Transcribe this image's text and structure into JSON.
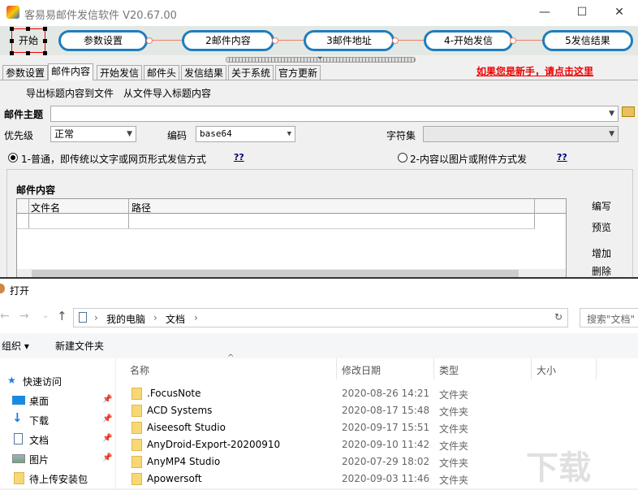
{
  "window": {
    "title": "客易易邮件发信软件 V20.67.00",
    "min": "—",
    "max": "☐",
    "close": "✕"
  },
  "flow": {
    "start": "开始",
    "steps": [
      "参数设置",
      "2邮件内容",
      "3邮件地址",
      "4-开始发信",
      "5发信结果"
    ]
  },
  "tabs": [
    "参数设置",
    "邮件内容",
    "开始发信",
    "邮件头",
    "发信结果",
    "关于系统",
    "官方更新"
  ],
  "newbie_link": "如果您是新手，请点击这里",
  "toolbar": {
    "export": "导出标题内容到文件",
    "import": "从文件导入标题内容"
  },
  "form": {
    "subject_label": "邮件主题",
    "subject_value": "",
    "priority_label": "优先级",
    "priority_value": "正常",
    "encoding_label": "编码",
    "encoding_value": "base64",
    "charset_label": "字符集",
    "charset_value": "",
    "radio1": "1-普通，即传统以文字或网页形式发信方式",
    "radio2": "2-内容以图片或附件方式发",
    "help": "??"
  },
  "content": {
    "title": "邮件内容",
    "columns": [
      "文件名",
      "路径"
    ],
    "buttons": [
      "编写",
      "预览",
      "增加",
      "删除"
    ]
  },
  "dialog": {
    "title": "打开",
    "breadcrumb": [
      "我的电脑",
      "文档"
    ],
    "search_placeholder": "搜索\"文档\"",
    "organize": "组织 ▾",
    "new_folder": "新建文件夹",
    "columns": [
      "名称",
      "修改日期",
      "类型",
      "大小"
    ],
    "nav": [
      "快速访问",
      "桌面",
      "下载",
      "文档",
      "图片",
      "待上传安装包"
    ],
    "files": [
      {
        "name": ".FocusNote",
        "date": "2020-08-26 14:21",
        "type": "文件夹"
      },
      {
        "name": "ACD Systems",
        "date": "2020-08-17 15:48",
        "type": "文件夹"
      },
      {
        "name": "Aiseesoft Studio",
        "date": "2020-09-17 15:51",
        "type": "文件夹"
      },
      {
        "name": "AnyDroid-Export-20200910",
        "date": "2020-09-10 11:42",
        "type": "文件夹"
      },
      {
        "name": "AnyMP4 Studio",
        "date": "2020-07-29 18:02",
        "type": "文件夹"
      },
      {
        "name": "Apowersoft",
        "date": "2020-09-03 11:46",
        "type": "文件夹"
      }
    ]
  }
}
